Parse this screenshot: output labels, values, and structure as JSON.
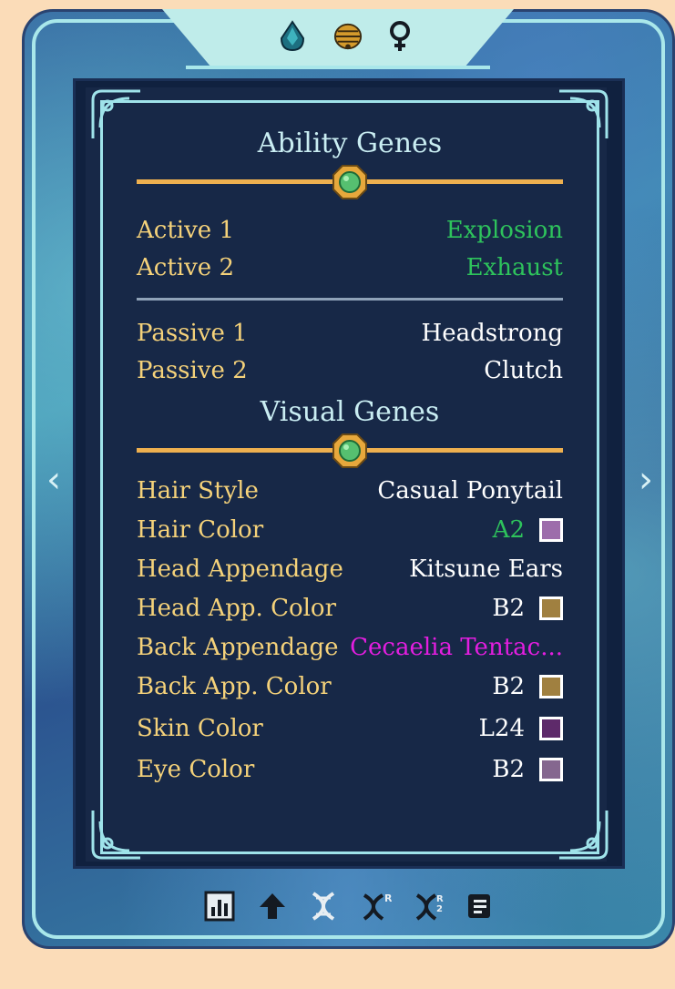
{
  "colors": {
    "label": "#f5d27a",
    "value_white": "#ffffff",
    "value_green": "#2ec35c",
    "value_magenta": "#e31ee0",
    "title": "#c9edf2",
    "gold_rule": "#eeb04f"
  },
  "header_icons": [
    "water-drop-icon",
    "hive-icon",
    "female-symbol-icon"
  ],
  "ability_section": {
    "title": "Ability Genes",
    "active": [
      {
        "label": "Active 1",
        "value": "Explosion",
        "value_color": "#2ec35c"
      },
      {
        "label": "Active 2",
        "value": "Exhaust",
        "value_color": "#2ec35c"
      }
    ],
    "passive": [
      {
        "label": "Passive 1",
        "value": "Headstrong",
        "value_color": "#ffffff"
      },
      {
        "label": "Passive 2",
        "value": "Clutch",
        "value_color": "#ffffff"
      }
    ]
  },
  "visual_section": {
    "title": "Visual Genes",
    "rows": [
      {
        "label": "Hair Style",
        "value": "Casual Ponytail",
        "value_color": "#ffffff",
        "swatch": null
      },
      {
        "label": "Hair Color",
        "value": "A2",
        "value_color": "#2ec35c",
        "swatch": "#9d6dab"
      },
      {
        "label": "Head Appendage",
        "value": "Kitsune Ears",
        "value_color": "#ffffff",
        "swatch": null
      },
      {
        "label": "Head App. Color",
        "value": "B2",
        "value_color": "#ffffff",
        "swatch": "#a08040"
      },
      {
        "label": "Back Appendage",
        "value": "Cecaelia Tentac...",
        "value_color": "#e31ee0",
        "swatch": null
      },
      {
        "label": "Back App. Color",
        "value": "B2",
        "value_color": "#ffffff",
        "swatch": "#a08040"
      },
      {
        "label": "Skin Color",
        "value": "L24",
        "value_color": "#ffffff",
        "swatch": "#5e2a6a"
      },
      {
        "label": "Eye Color",
        "value": "B2",
        "value_color": "#ffffff",
        "swatch": "#85678f"
      }
    ]
  },
  "nav": {
    "prev": "‹",
    "next": "›"
  },
  "bottom_icons": [
    "stats-chart-icon",
    "level-up-arrow-icon",
    "dna-icon",
    "dna-recessive-1-icon",
    "dna-recessive-2-icon",
    "scroll-icon"
  ]
}
